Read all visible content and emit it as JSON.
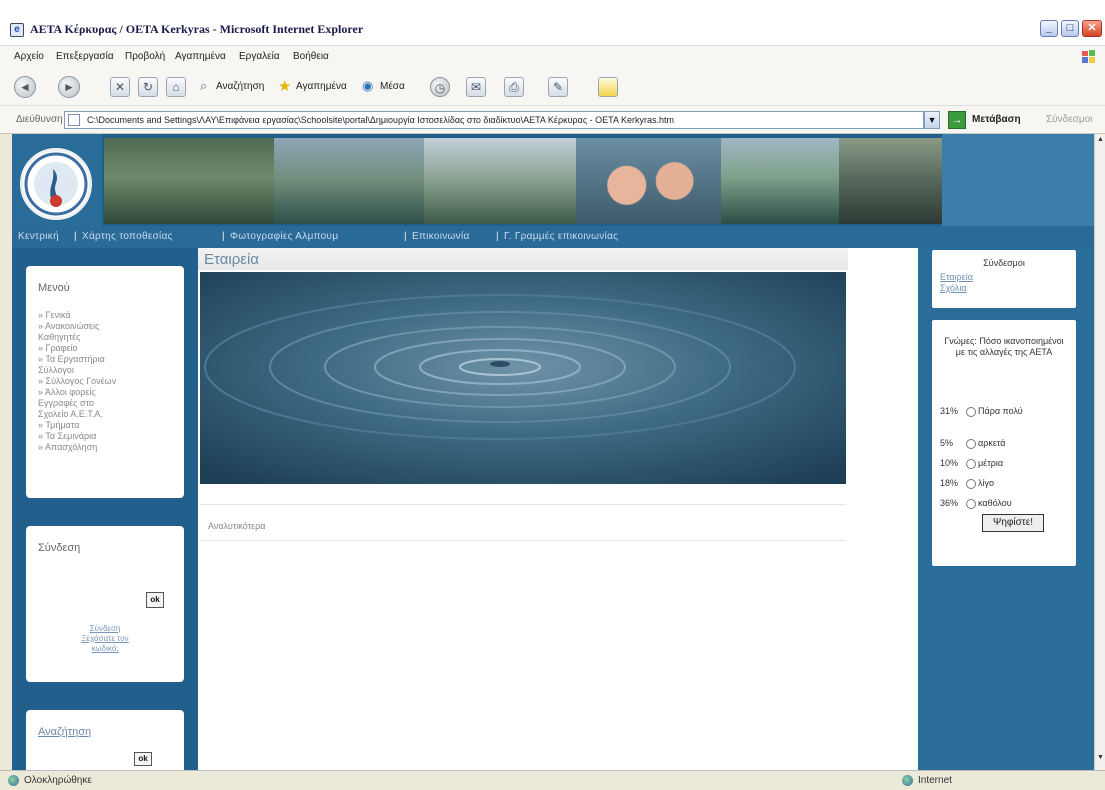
{
  "window": {
    "title": "ΑΕΤΑ Κέρκυρας / ΟΕΤΑ Kerkyras - Microsoft Internet Explorer",
    "minimize": "_",
    "maximize": "□",
    "close": "✕"
  },
  "menubar": {
    "items": [
      "Αρχείο",
      "Επεξεργασία",
      "Προβολή",
      "Αγαπημένα",
      "Εργαλεία",
      "Βοήθεια"
    ]
  },
  "toolbar": {
    "back": "◄",
    "forward": "►",
    "stop": "✕",
    "refresh": "↻",
    "home": "⌂",
    "search_label": "Αναζήτηση",
    "favorites_label": "Αγαπημένα",
    "media_label": "Μέσα"
  },
  "addressbar": {
    "label": "Διεύθυνση",
    "url": "C:\\Documents and Settings\\ΛΑΥ\\Επιφάνεια εργασίας\\Schoolsite\\portal\\Δημιουργία Ιστοσελίδας στο διαδίκτυο\\ΑΕΤΑ Κέρκυρας - ΟΕΤΑ Kerkyras.htm",
    "go_label": "Μετάβαση",
    "links_label": "Σύνδεσμοι"
  },
  "site": {
    "navbar": [
      "Κεντρική",
      "Χάρτης τοποθεσίας",
      "Φωτογραφίες Αλμπουμ",
      "Επικοινωνία",
      "Γ. Γραμμές επικοινωνίας"
    ],
    "left_menu": {
      "title": "Μενού",
      "lines": [
        "» Γενικά",
        "» Ανακοινώσεις",
        "Καθηγητές",
        "» Γραφείο",
        "» Τα Εργαστήρια",
        "Σύλλογοι",
        "» Σύλλογος Γονέων",
        "» Άλλοι φορείς",
        "Εγγραφές στο",
        "Σχολείο Α.Ε.Τ.Α.",
        "» Τμήματα",
        "» Τα Σεμινάρια",
        "» Απασχόληση"
      ]
    },
    "login_box": {
      "title": "Σύνδεση",
      "ok": "ok",
      "link_line1": "Σύνδεση",
      "link_line2": "Ξεχάσατε τον",
      "link_line3": "κωδικό;"
    },
    "search_box": {
      "title": "Αναζήτηση",
      "ok": "ok"
    },
    "main": {
      "page_title": "Εταιρεία",
      "more_link": "Αναλυτικότερα"
    },
    "right_links": {
      "title": "Σύνδεσμοι",
      "links": [
        "Εταιρεία",
        "Σχόλια"
      ]
    },
    "poll": {
      "question": "Γνώμες: Πόσο ικανοποιημένοι με τις αλλαγές της ΑΕΤΑ",
      "options": [
        {
          "pct": "31%",
          "label": "Πάρα πολύ"
        },
        {
          "pct": "5%",
          "label": "αρκετά"
        },
        {
          "pct": "10%",
          "label": "μέτρια"
        },
        {
          "pct": "18%",
          "label": "λίγο"
        },
        {
          "pct": "36%",
          "label": "καθόλου"
        }
      ],
      "vote_label": "Ψηφίστε!"
    }
  },
  "statusbar": {
    "left": "Ολοκληρώθηκε",
    "right": "Internet"
  },
  "colors": {
    "site_blue": "#1f5f8a",
    "nav_blue": "#2a6a98",
    "link_blue": "#6f8fb8"
  }
}
